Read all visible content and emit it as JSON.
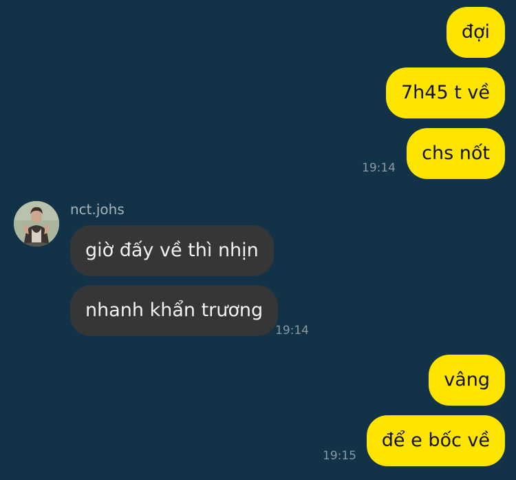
{
  "conversation": {
    "messages_out_1": {
      "m1": "đợi",
      "m2": "7h45 t về",
      "m3": "chs nốt",
      "time": "19:14"
    },
    "incoming": {
      "sender": "nct.johs",
      "m1": "giờ đấy về thì nhịn",
      "m2": "nhanh khẩn trương",
      "time": "19:14"
    },
    "messages_out_2": {
      "m1": "vâng",
      "m2": "để e bốc về",
      "time": "19:15"
    }
  },
  "colors": {
    "background": "#123347",
    "outgoing_bubble": "#fee500",
    "incoming_bubble": "#353638",
    "timestamp": "#8c9aa4"
  },
  "icons": {
    "avatar": "profile-photo-avatar"
  }
}
